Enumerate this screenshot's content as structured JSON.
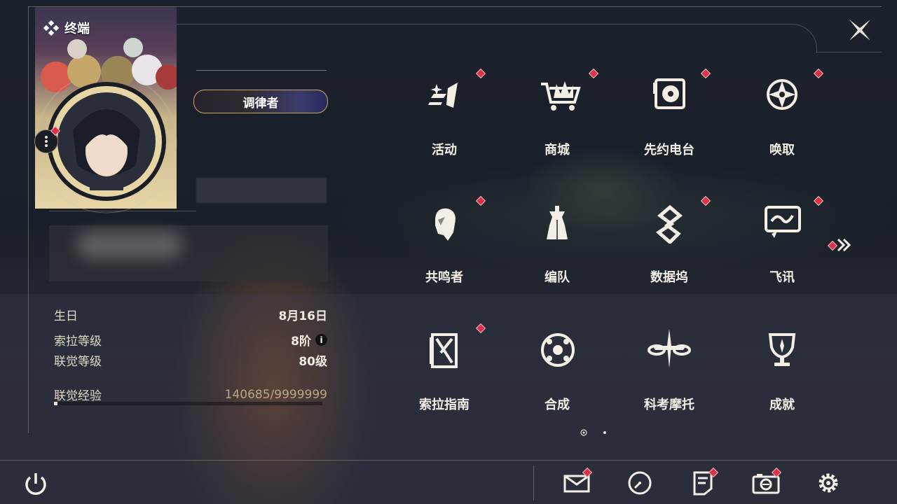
{
  "header": {
    "terminal_label": "终端"
  },
  "profile": {
    "title_badge": "调律者",
    "stats": [
      {
        "label": "生日",
        "value": "8月16日"
      },
      {
        "label": "索拉等级",
        "value": "8阶"
      },
      {
        "label": "联觉等级",
        "value": "80级"
      }
    ],
    "exp": {
      "label": "联觉经验",
      "value": "140685/9999999",
      "progress": 0.014
    }
  },
  "menu": {
    "items": [
      {
        "label": "活动",
        "icon": "activity-icon",
        "badge": true
      },
      {
        "label": "商城",
        "icon": "shop-cart-icon",
        "badge": true
      },
      {
        "label": "先约电台",
        "icon": "radio-icon",
        "badge": true
      },
      {
        "label": "唤取",
        "icon": "summon-icon",
        "badge": true
      },
      {
        "label": "共鸣者",
        "icon": "resonator-icon",
        "badge": true
      },
      {
        "label": "编队",
        "icon": "team-icon",
        "badge": false
      },
      {
        "label": "数据坞",
        "icon": "data-bank-icon",
        "badge": true
      },
      {
        "label": "飞讯",
        "icon": "message-icon",
        "badge": true
      },
      {
        "label": "索拉指南",
        "icon": "guide-icon",
        "badge": true
      },
      {
        "label": "合成",
        "icon": "synthesis-icon",
        "badge": false
      },
      {
        "label": "科考摩托",
        "icon": "motorcycle-icon",
        "badge": false
      },
      {
        "label": "成就",
        "icon": "trophy-icon",
        "badge": false
      }
    ],
    "page": {
      "current": 1,
      "total": 2
    }
  },
  "bottom_bar": {
    "icons": [
      "mail-icon",
      "clock-icon",
      "notes-icon",
      "camera-icon",
      "settings-icon"
    ]
  },
  "colors": {
    "accent_red": "#d8334a",
    "gold": "#c9a664",
    "text": "#f3efe6"
  }
}
